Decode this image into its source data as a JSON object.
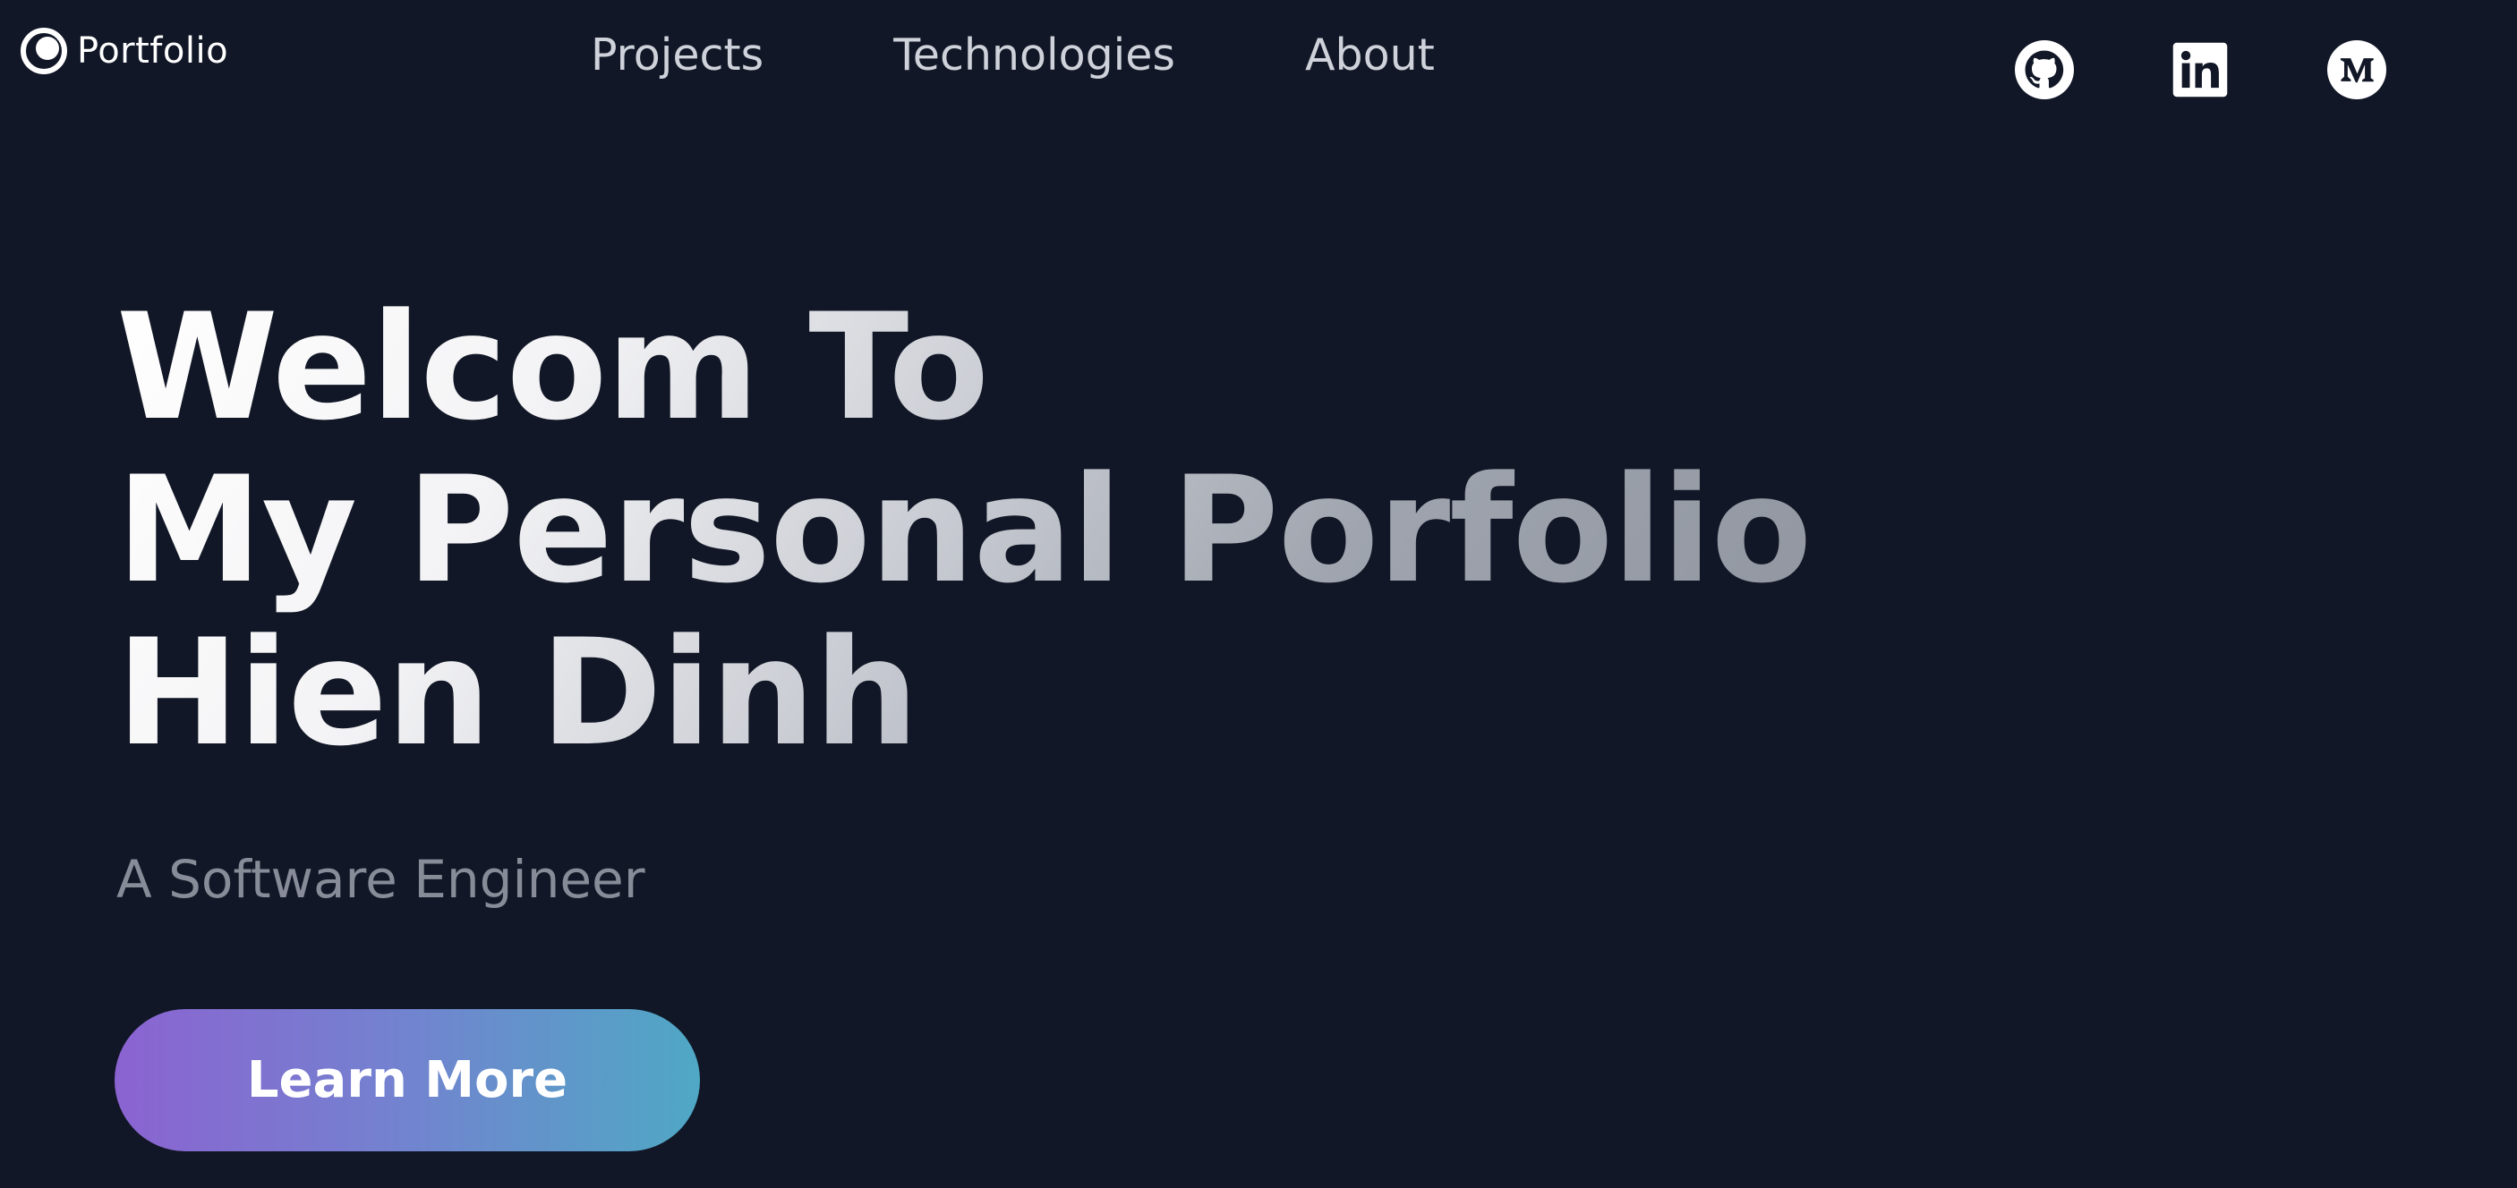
{
  "header": {
    "logo_text": "Portfolio",
    "logo_icon": "portfolio-logo-icon",
    "nav": [
      {
        "label": "Projects"
      },
      {
        "label": "Technologies"
      },
      {
        "label": "About"
      }
    ],
    "socials": [
      {
        "icon": "github-icon",
        "label": "GitHub"
      },
      {
        "icon": "linkedin-icon",
        "label": "LinkedIn"
      },
      {
        "icon": "medium-icon",
        "label": "Medium"
      }
    ]
  },
  "hero": {
    "title_lines": [
      "Welcom To",
      "My Personal Porfolio",
      "Hien Dinh"
    ],
    "subtitle": "A Software Engineer",
    "cta_label": "Learn More"
  },
  "colors": {
    "background": "#111726",
    "nav_text": "#cfd2da",
    "subtitle_text": "#878c98",
    "cta_gradient_start": "#8b63d1",
    "cta_gradient_end": "#4fa8c5"
  }
}
